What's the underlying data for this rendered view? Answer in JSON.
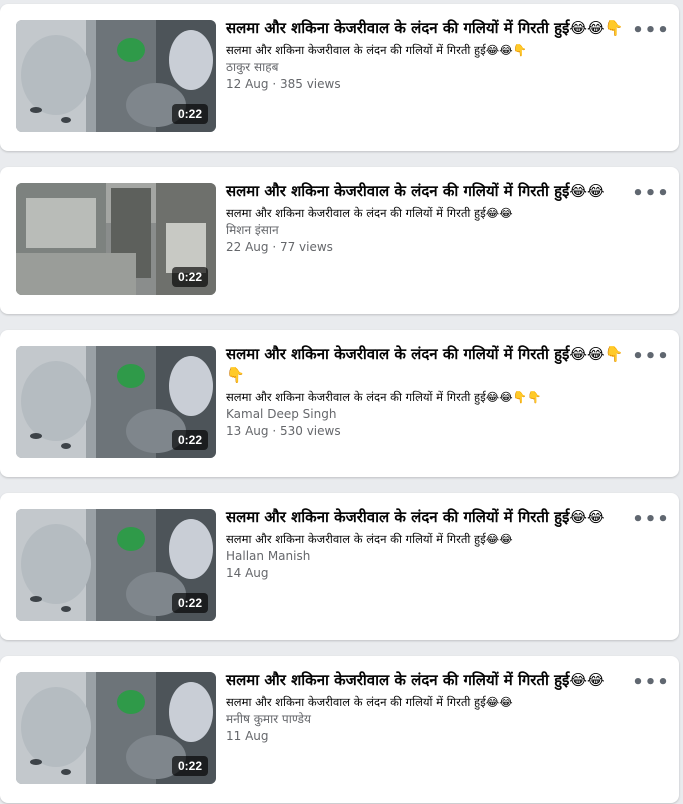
{
  "videos": [
    {
      "title": "सलमा और शकिना केजरीवाल के लंदन की गलियों में गिरती हुई😂😂👇",
      "description": "सलमा और शकिना केजरीवाल के लंदन की गलियों में गिरती हुई😂😂👇",
      "author": "ठाकुर साहब",
      "date": "12 Aug",
      "views": "385 views",
      "duration": "0:22",
      "thumb_variant": "a"
    },
    {
      "title": "सलमा और शकिना केजरीवाल के लंदन की गलियों में गिरती हुई😂😂",
      "description": "सलमा और शकिना केजरीवाल के लंदन की गलियों में गिरती हुई😂😂",
      "author": "मिशन इंसान",
      "date": "22 Aug",
      "views": "77 views",
      "duration": "0:22",
      "thumb_variant": "b"
    },
    {
      "title": "सलमा और शकिना केजरीवाल के लंदन की गलियों में गिरती हुई😂😂👇👇",
      "description": "सलमा और शकिना केजरीवाल के लंदन की गलियों में गिरती हुई😂😂👇👇",
      "author": "Kamal Deep Singh",
      "date": "13 Aug",
      "views": "530 views",
      "duration": "0:22",
      "thumb_variant": "a"
    },
    {
      "title": "सलमा और शकिना केजरीवाल के लंदन की गलियों में गिरती हुई😂😂",
      "description": "सलमा और शकिना केजरीवाल के लंदन की गलियों में गिरती हुई😂😂",
      "author": "Hallan Manish",
      "date": "14 Aug",
      "views": "",
      "duration": "0:22",
      "thumb_variant": "a"
    },
    {
      "title": "सलमा और शकिना केजरीवाल के लंदन की गलियों में गिरती हुई😂😂",
      "description": "सलमा और शकिना केजरीवाल के लंदन की गलियों में गिरती हुई😂😂",
      "author": "मनीष कुमार पाण्डेय",
      "date": "11 Aug",
      "views": "",
      "duration": "0:22",
      "thumb_variant": "a"
    }
  ],
  "more_icon": "more-horizontal-icon",
  "colors": {
    "background": "#e9ebee",
    "card": "#ffffff",
    "title": "#050505",
    "meta": "#65676b"
  }
}
